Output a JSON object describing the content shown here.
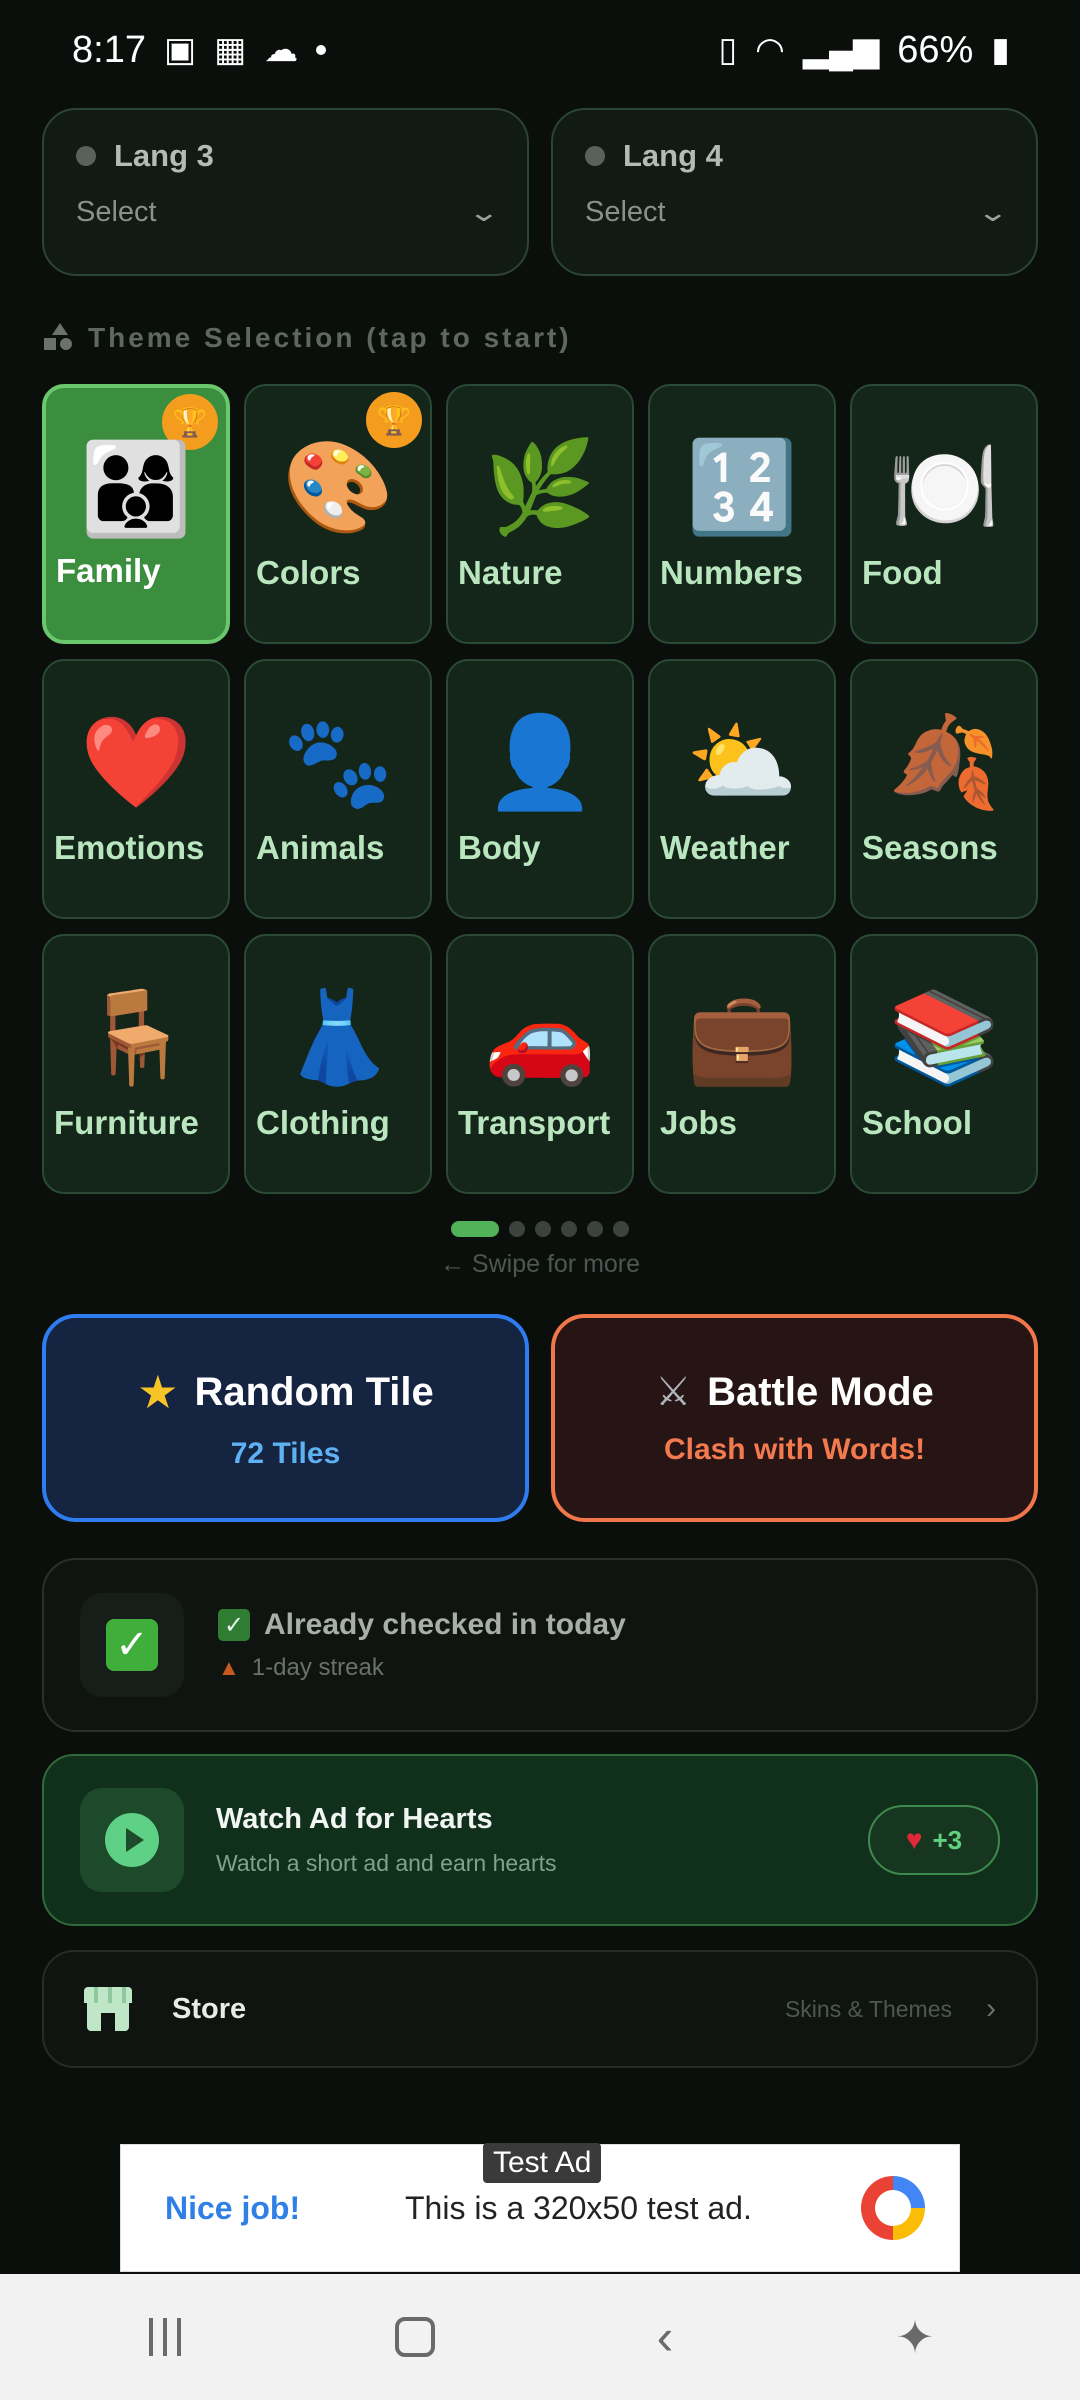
{
  "status": {
    "time": "8:17",
    "battery": "66%",
    "icons": [
      "gallery-icon",
      "photo-icon",
      "cloud-icon",
      "battery-saver-icon",
      "wifi-icon",
      "signal-icon",
      "battery-icon"
    ]
  },
  "langs": [
    {
      "title": "Lang 3",
      "value": "Select"
    },
    {
      "title": "Lang 4",
      "value": "Select"
    }
  ],
  "theme_header": "Theme Selection (tap to start)",
  "themes": [
    {
      "label": "Family",
      "emoji": "👨‍👩‍👦",
      "trophy": true,
      "active": true
    },
    {
      "label": "Colors",
      "emoji": "🎨",
      "trophy": true,
      "active": false
    },
    {
      "label": "Nature",
      "emoji": "🌿",
      "trophy": false,
      "active": false
    },
    {
      "label": "Numbers",
      "emoji": "🔢",
      "trophy": false,
      "active": false
    },
    {
      "label": "Food",
      "emoji": "🍽️",
      "trophy": false,
      "active": false
    },
    {
      "label": "Emotions",
      "emoji": "❤️",
      "trophy": false,
      "active": false
    },
    {
      "label": "Animals",
      "emoji": "🐾",
      "trophy": false,
      "active": false
    },
    {
      "label": "Body",
      "emoji": "👤",
      "trophy": false,
      "active": false
    },
    {
      "label": "Weather",
      "emoji": "⛅",
      "trophy": false,
      "active": false
    },
    {
      "label": "Seasons",
      "emoji": "🍂",
      "trophy": false,
      "active": false
    },
    {
      "label": "Furniture",
      "emoji": "🪑",
      "trophy": false,
      "active": false
    },
    {
      "label": "Clothing",
      "emoji": "👗",
      "trophy": false,
      "active": false
    },
    {
      "label": "Transport",
      "emoji": "🚗",
      "trophy": false,
      "active": false
    },
    {
      "label": "Jobs",
      "emoji": "💼",
      "trophy": false,
      "active": false
    },
    {
      "label": "School",
      "emoji": "📚",
      "trophy": false,
      "active": false
    }
  ],
  "pager": {
    "count": 6,
    "active": 0,
    "hint": "← Swipe for more"
  },
  "random": {
    "title": "Random Tile",
    "sub": "72 Tiles"
  },
  "battle": {
    "title": "Battle Mode",
    "sub": "Clash with Words!"
  },
  "checkin": {
    "title": "Already checked in today",
    "streak": "1-day streak"
  },
  "watch_ad": {
    "title": "Watch Ad for Hearts",
    "sub": "Watch a short ad and earn hearts",
    "reward": "+3"
  },
  "store": {
    "label": "Store",
    "sub": "Skins & Themes"
  },
  "ad": {
    "tag": "Test Ad",
    "nice": "Nice job!",
    "text": "This is a 320x50 test ad."
  },
  "colors": {
    "accent_green": "#52b25a",
    "random_border": "#2f7cf0",
    "battle_border": "#f0774a",
    "trophy": "#f39c1e"
  }
}
